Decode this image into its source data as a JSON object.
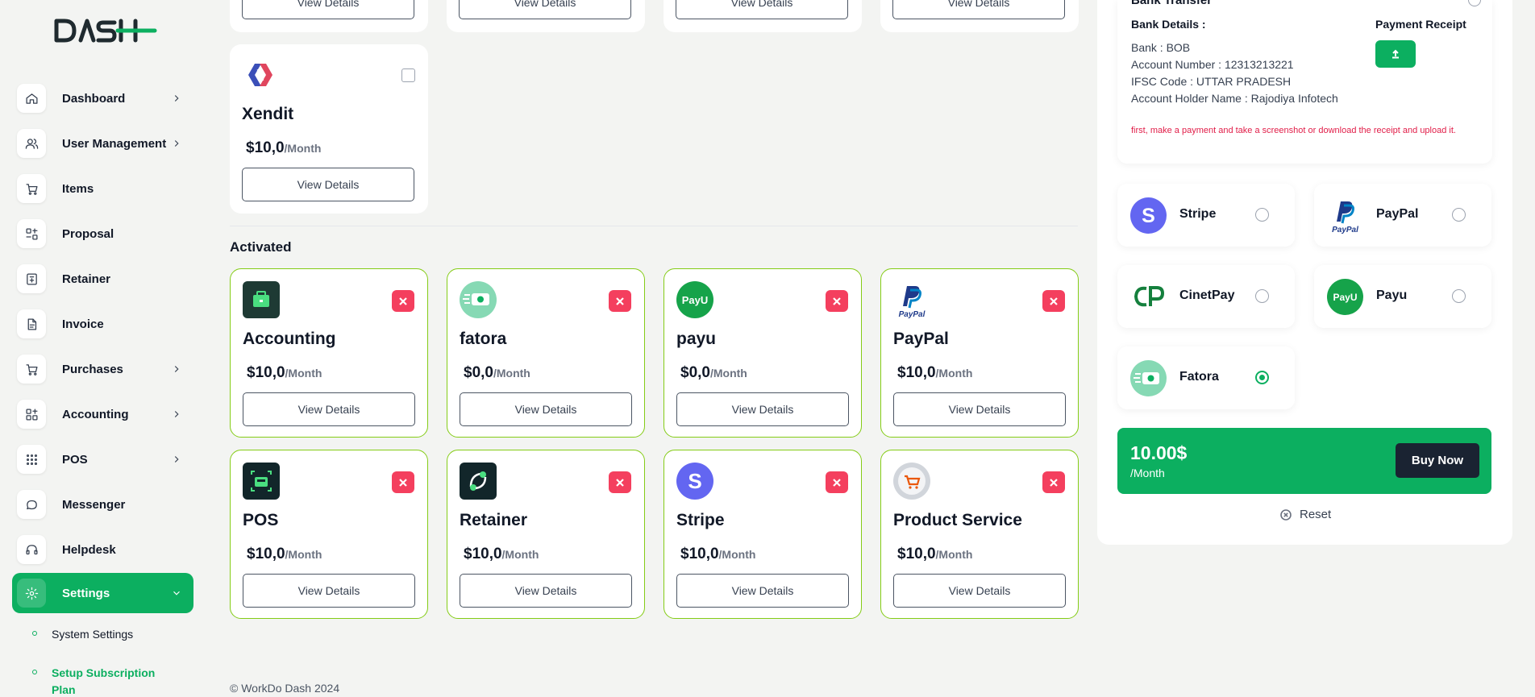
{
  "brand": {
    "accent": "#0caf60",
    "danger": "#f43f5e",
    "activated_border": "#84cc16"
  },
  "sidebar": {
    "items": [
      {
        "label": "Dashboard",
        "icon": "home-icon",
        "has_chevron": true
      },
      {
        "label": "User Management",
        "icon": "users-icon",
        "has_chevron": true
      },
      {
        "label": "Items",
        "icon": "cart-icon",
        "has_chevron": false
      },
      {
        "label": "Proposal",
        "icon": "proposal-icon",
        "has_chevron": false
      },
      {
        "label": "Retainer",
        "icon": "retainer-icon",
        "has_chevron": false
      },
      {
        "label": "Invoice",
        "icon": "invoice-icon",
        "has_chevron": false
      },
      {
        "label": "Purchases",
        "icon": "cart-icon",
        "has_chevron": true
      },
      {
        "label": "Accounting",
        "icon": "grid-icon",
        "has_chevron": true
      },
      {
        "label": "POS",
        "icon": "dots-grid-icon",
        "has_chevron": true
      },
      {
        "label": "Messenger",
        "icon": "chat-icon",
        "has_chevron": false
      },
      {
        "label": "Helpdesk",
        "icon": "headset-icon",
        "has_chevron": false
      },
      {
        "label": "Settings",
        "icon": "gear-icon",
        "has_chevron": true,
        "active": true
      }
    ],
    "sub_items": [
      {
        "label": "System Settings"
      },
      {
        "label": "Setup Subscription Plan",
        "current": true
      }
    ]
  },
  "cards": {
    "view_details_label": "View Details",
    "top_partial": [
      "View Details",
      "View Details",
      "View Details",
      "View Details"
    ],
    "available": [
      {
        "name": "Xendit",
        "price": "$10,0",
        "per": "/Month"
      }
    ],
    "activated_section_title": "Activated",
    "activated": [
      {
        "name": "Accounting",
        "price": "$10,0",
        "per": "/Month",
        "logo": "briefcase-icon"
      },
      {
        "name": "fatora",
        "price": "$0,0",
        "per": "/Month",
        "logo": "fatora-icon"
      },
      {
        "name": "payu",
        "price": "$0,0",
        "per": "/Month",
        "logo": "payu-icon"
      },
      {
        "name": "PayPal",
        "price": "$10,0",
        "per": "/Month",
        "logo": "paypal-icon"
      },
      {
        "name": "POS",
        "price": "$10,0",
        "per": "/Month",
        "logo": "pos-icon"
      },
      {
        "name": "Retainer",
        "price": "$10,0",
        "per": "/Month",
        "logo": "retainer-logo-icon"
      },
      {
        "name": "Stripe",
        "price": "$10,0",
        "per": "/Month",
        "logo": "stripe-icon"
      },
      {
        "name": "Product Service",
        "price": "$10,0",
        "per": "/Month",
        "logo": "product-service-icon"
      }
    ]
  },
  "footer": "© WorkDo Dash 2024",
  "payment_panel": {
    "bank_transfer_title": "Bank Transfer",
    "bank_details_heading": "Bank Details :",
    "bank_lines": [
      "Bank : BOB",
      "Account Number : 12313213221",
      "IFSC Code : UTTAR PRADESH",
      "Account Holder Name : Rajodiya Infotech"
    ],
    "payment_receipt_heading": "Payment Receipt",
    "note": "first, make a payment and take a screenshot or download the receipt and upload it.",
    "methods": [
      {
        "name": "Stripe",
        "selected": false
      },
      {
        "name": "PayPal",
        "selected": false
      },
      {
        "name": "CinetPay",
        "selected": false
      },
      {
        "name": "Payu",
        "selected": false
      },
      {
        "name": "Fatora",
        "selected": true
      }
    ],
    "total": {
      "amount": "10.00$",
      "per": "/Month"
    },
    "buy_now_label": "Buy Now",
    "reset_label": "Reset"
  }
}
